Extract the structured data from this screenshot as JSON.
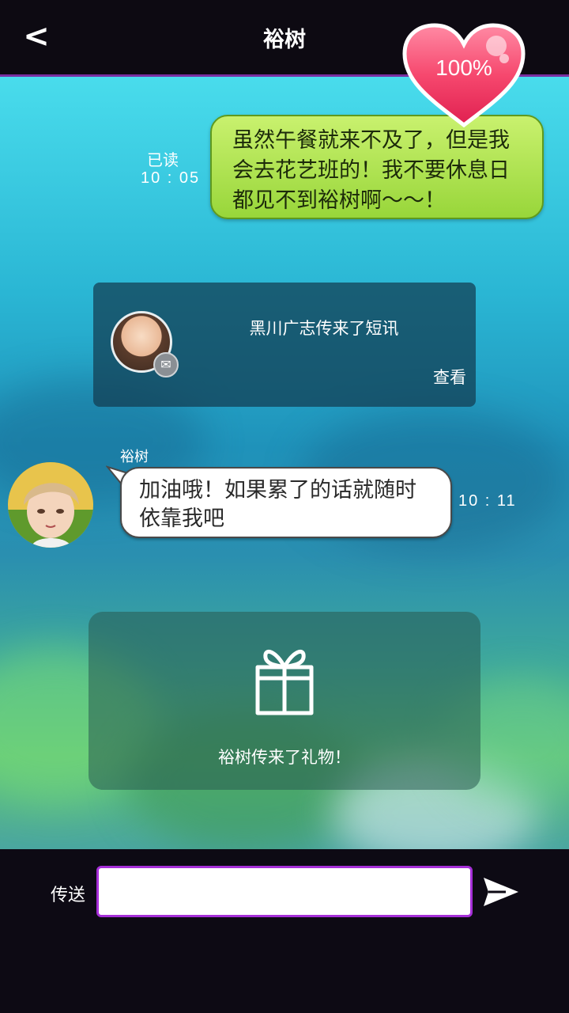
{
  "header": {
    "back_label": "<",
    "title": "裕树"
  },
  "affection": {
    "percent_label": "100%",
    "value": 100
  },
  "messages": {
    "sent": {
      "text": "虽然午餐就来不及了，但是我会去花艺班的！我不要休息日都见不到裕树啊～～！",
      "status": "已读",
      "time": "10 : 05"
    },
    "notice": {
      "text": "黑川广志传来了短讯",
      "action": "查看",
      "icon": "mail-icon"
    },
    "received": {
      "sender": "裕树",
      "text": "加油哦！如果累了的话就随时依靠我吧",
      "time": "10 : 11"
    },
    "gift": {
      "text": "裕树传来了礼物！",
      "icon": "gift-icon"
    }
  },
  "composer": {
    "send_label": "传送",
    "input_value": "",
    "send_icon": "send-arrow-icon"
  },
  "colors": {
    "sent_bubble": "#b4e657",
    "input_border": "#a62fd8",
    "heart": "#f0466a"
  }
}
